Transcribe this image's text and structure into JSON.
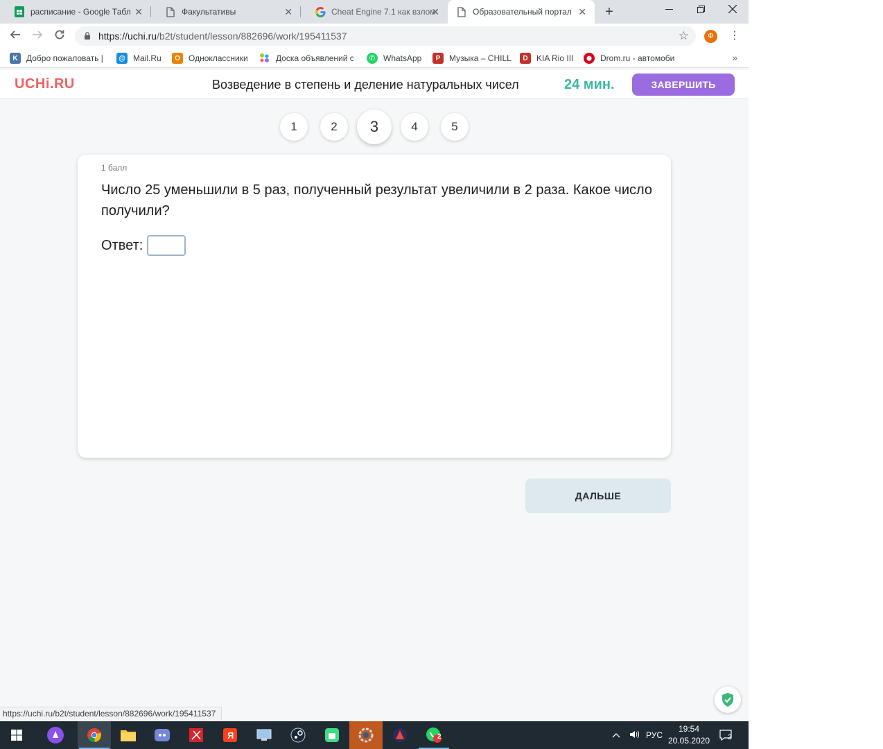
{
  "browser": {
    "tabs": [
      {
        "label": "расписание - Google Табл",
        "icon": "sheets-icon"
      },
      {
        "label": "Факультативы",
        "icon": "document-icon"
      },
      {
        "label": "Cheat Engine 7.1 как взлом",
        "icon": "google-icon"
      },
      {
        "label": "Образовательный портал",
        "icon": "document-icon"
      }
    ],
    "url_host": "https://uchi.ru",
    "url_path": "/b2t/student/lesson/882696/work/195411537",
    "profile_initial": "Ф",
    "bookmarks": [
      {
        "label": "Добро пожаловать |",
        "icon": "vk-icon",
        "color": "#4a76a8"
      },
      {
        "label": "Mail.Ru",
        "icon": "mailru-icon",
        "color": "#168de2"
      },
      {
        "label": "Одноклассники",
        "icon": "odnoklassniki-icon",
        "color": "#ee8208"
      },
      {
        "label": "Доска объявлений с",
        "icon": "avito-icon",
        "color": "#97cf26"
      },
      {
        "label": "WhatsApp",
        "icon": "whatsapp-icon",
        "color": "#25d366"
      },
      {
        "label": "Музыка – CHILL",
        "icon": "music-p-icon",
        "color": "#c4302b"
      },
      {
        "label": "KIA Rio III",
        "icon": "drive2-icon",
        "color": "#c4302b"
      },
      {
        "label": "Drom.ru - автомоби",
        "icon": "drom-icon",
        "color": "#db001b"
      }
    ]
  },
  "site": {
    "logo": "UCHi.RU",
    "lesson_title": "Возведение в степень и деление натуральных чисел",
    "timer": "24 мин.",
    "finish_label": "ЗАВЕРШИТЬ",
    "pages": [
      "1",
      "2",
      "3",
      "4",
      "5"
    ],
    "active_page": "3"
  },
  "task": {
    "points": "1 балл",
    "question": "Число 25 уменьшили в 5 раз, полученный результат увеличили в 2 раза. Какое число получили?",
    "answer_label": "Ответ:",
    "answer_value": ""
  },
  "next_label": "ДАЛЬШЕ",
  "status_url": "https://uchi.ru/b2t/student/lesson/882696/work/195411537",
  "taskbar": {
    "language": "РУС",
    "time": "19:54",
    "date": "20.05.2020",
    "notifications": "2",
    "whatsapp_badge": "2"
  }
}
